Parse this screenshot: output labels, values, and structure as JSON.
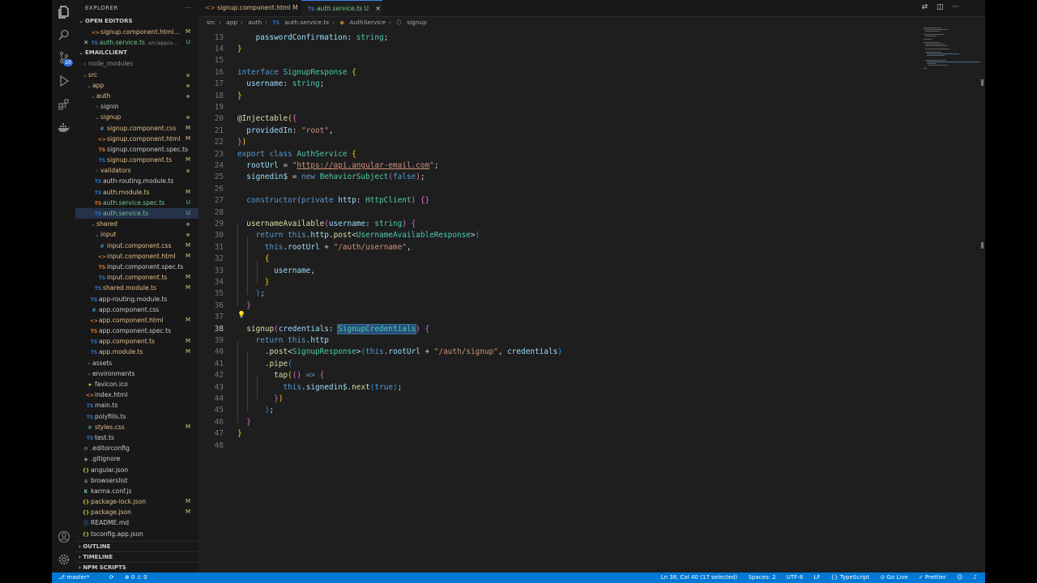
{
  "sidebar": {
    "title": "EXPLORER",
    "open_editors": "OPEN EDITORS",
    "project": "EMAILCLIENT",
    "outline": "OUTLINE",
    "timeline": "TIMELINE",
    "npm_scripts": "NPM SCRIPTS",
    "open_files": [
      {
        "name": "signup.component.html...",
        "status": "M"
      },
      {
        "name": "auth.service.ts",
        "path": "src/app/a...",
        "status": "U"
      }
    ],
    "tree": [
      {
        "label": "node_modules",
        "depth": 0,
        "kind": "folder",
        "status": ""
      },
      {
        "label": "src",
        "depth": 0,
        "kind": "folder-open",
        "status": "dot"
      },
      {
        "label": "app",
        "depth": 1,
        "kind": "folder-open",
        "status": "dot"
      },
      {
        "label": "auth",
        "depth": 2,
        "kind": "folder-open",
        "status": "dot"
      },
      {
        "label": "signin",
        "depth": 3,
        "kind": "folder",
        "status": ""
      },
      {
        "label": "signup",
        "depth": 3,
        "kind": "folder-open",
        "status": "dot"
      },
      {
        "label": "signup.component.css",
        "depth": 4,
        "kind": "css",
        "status": "M"
      },
      {
        "label": "signup.component.html",
        "depth": 4,
        "kind": "html",
        "status": "M"
      },
      {
        "label": "signup.component.spec.ts",
        "depth": 4,
        "kind": "spec",
        "status": ""
      },
      {
        "label": "signup.component.ts",
        "depth": 4,
        "kind": "ts",
        "status": "M"
      },
      {
        "label": "validators",
        "depth": 3,
        "kind": "folder",
        "status": "dot"
      },
      {
        "label": "auth-routing.module.ts",
        "depth": 3,
        "kind": "ts",
        "status": ""
      },
      {
        "label": "auth.module.ts",
        "depth": 3,
        "kind": "ts",
        "status": "M"
      },
      {
        "label": "auth.service.spec.ts",
        "depth": 3,
        "kind": "spec",
        "status": "U"
      },
      {
        "label": "auth.service.ts",
        "depth": 3,
        "kind": "ts",
        "status": "U",
        "selected": true
      },
      {
        "label": "shared",
        "depth": 2,
        "kind": "folder-open",
        "status": "dot"
      },
      {
        "label": "input",
        "depth": 3,
        "kind": "folder-open",
        "status": "dot"
      },
      {
        "label": "input.component.css",
        "depth": 4,
        "kind": "css",
        "status": "M"
      },
      {
        "label": "input.component.html",
        "depth": 4,
        "kind": "html",
        "status": "M"
      },
      {
        "label": "input.component.spec.ts",
        "depth": 4,
        "kind": "spec",
        "status": ""
      },
      {
        "label": "input.component.ts",
        "depth": 4,
        "kind": "ts",
        "status": "M"
      },
      {
        "label": "shared.module.ts",
        "depth": 3,
        "kind": "ts",
        "status": "M"
      },
      {
        "label": "app-routing.module.ts",
        "depth": 2,
        "kind": "ts",
        "status": ""
      },
      {
        "label": "app.component.css",
        "depth": 2,
        "kind": "css",
        "status": ""
      },
      {
        "label": "app.component.html",
        "depth": 2,
        "kind": "html",
        "status": "M"
      },
      {
        "label": "app.component.spec.ts",
        "depth": 2,
        "kind": "spec",
        "status": ""
      },
      {
        "label": "app.component.ts",
        "depth": 2,
        "kind": "ts",
        "status": "M"
      },
      {
        "label": "app.module.ts",
        "depth": 2,
        "kind": "ts",
        "status": "M"
      },
      {
        "label": "assets",
        "depth": 1,
        "kind": "folder",
        "status": ""
      },
      {
        "label": "environments",
        "depth": 1,
        "kind": "folder",
        "status": ""
      },
      {
        "label": "favicon.ico",
        "depth": 1,
        "kind": "ico",
        "status": ""
      },
      {
        "label": "index.html",
        "depth": 1,
        "kind": "html",
        "status": ""
      },
      {
        "label": "main.ts",
        "depth": 1,
        "kind": "ts",
        "status": ""
      },
      {
        "label": "polyfills.ts",
        "depth": 1,
        "kind": "ts",
        "status": ""
      },
      {
        "label": "styles.css",
        "depth": 1,
        "kind": "css",
        "status": "M"
      },
      {
        "label": "test.ts",
        "depth": 1,
        "kind": "ts",
        "status": ""
      },
      {
        "label": ".editorconfig",
        "depth": 0,
        "kind": "cfg",
        "status": ""
      },
      {
        "label": ".gitignore",
        "depth": 0,
        "kind": "git",
        "status": ""
      },
      {
        "label": "angular.json",
        "depth": 0,
        "kind": "json",
        "status": ""
      },
      {
        "label": "browserslist",
        "depth": 0,
        "kind": "list",
        "status": ""
      },
      {
        "label": "karma.conf.js",
        "depth": 0,
        "kind": "karma",
        "status": ""
      },
      {
        "label": "package-lock.json",
        "depth": 0,
        "kind": "json",
        "status": "M"
      },
      {
        "label": "package.json",
        "depth": 0,
        "kind": "json",
        "status": "M"
      },
      {
        "label": "README.md",
        "depth": 0,
        "kind": "md",
        "status": ""
      },
      {
        "label": "tsconfig.app.json",
        "depth": 0,
        "kind": "json",
        "status": ""
      }
    ]
  },
  "tabs": [
    {
      "label": "signup.component.html",
      "status": "M",
      "active": false,
      "icon": "<>"
    },
    {
      "label": "auth.service.ts",
      "status": "U",
      "active": true,
      "icon": "TS"
    }
  ],
  "breadcrumb": [
    "src",
    "app",
    "auth",
    "auth.service.ts",
    "AuthService",
    "signup"
  ],
  "code": [
    {
      "n": 13,
      "t": [
        [
          "    ",
          ""
        ],
        [
          "passwordConfirmation",
          "vr"
        ],
        [
          ": ",
          ""
        ],
        [
          "string",
          "ty"
        ],
        [
          ";",
          ""
        ]
      ]
    },
    {
      "n": 14,
      "t": [
        [
          "}",
          "pn"
        ]
      ]
    },
    {
      "n": 15,
      "t": []
    },
    {
      "n": 16,
      "t": [
        [
          "interface ",
          "kw"
        ],
        [
          "SignupResponse ",
          "ty"
        ],
        [
          "{",
          "pn"
        ]
      ]
    },
    {
      "n": 17,
      "t": [
        [
          "  ",
          ""
        ],
        [
          "username",
          "vr"
        ],
        [
          ": ",
          ""
        ],
        [
          "string",
          "ty"
        ],
        [
          ";",
          ""
        ]
      ]
    },
    {
      "n": 18,
      "t": [
        [
          "}",
          "pn"
        ]
      ]
    },
    {
      "n": 19,
      "t": []
    },
    {
      "n": 20,
      "t": [
        [
          "@",
          "dc"
        ],
        [
          "Injectable",
          "dc"
        ],
        [
          "(",
          "pn"
        ],
        [
          "{",
          "pp"
        ]
      ]
    },
    {
      "n": 21,
      "t": [
        [
          "  ",
          ""
        ],
        [
          "providedIn",
          "vr"
        ],
        [
          ": ",
          ""
        ],
        [
          "\"root\"",
          "st"
        ],
        [
          ",",
          ""
        ]
      ]
    },
    {
      "n": 22,
      "t": [
        [
          "}",
          "pp"
        ],
        [
          ")",
          "pn"
        ]
      ]
    },
    {
      "n": 23,
      "t": [
        [
          "export ",
          "kw"
        ],
        [
          "class ",
          "kw"
        ],
        [
          "AuthService ",
          "ty"
        ],
        [
          "{",
          "pn"
        ]
      ]
    },
    {
      "n": 24,
      "t": [
        [
          "  ",
          ""
        ],
        [
          "rootUrl",
          "vr"
        ],
        [
          " = ",
          ""
        ],
        [
          "\"",
          "st"
        ],
        [
          "https://api.angular-email.com",
          "ur"
        ],
        [
          "\"",
          "st"
        ],
        [
          ";",
          ""
        ]
      ]
    },
    {
      "n": 25,
      "t": [
        [
          "  ",
          ""
        ],
        [
          "signedin$",
          "vr"
        ],
        [
          " = ",
          ""
        ],
        [
          "new ",
          "kw"
        ],
        [
          "BehaviorSubject",
          "ty"
        ],
        [
          "(",
          "pp"
        ],
        [
          "false",
          "kw"
        ],
        [
          ")",
          "pp"
        ],
        [
          ";",
          ""
        ]
      ]
    },
    {
      "n": 26,
      "t": []
    },
    {
      "n": 27,
      "t": [
        [
          "  ",
          ""
        ],
        [
          "constructor",
          "kw"
        ],
        [
          "(",
          "pp"
        ],
        [
          "private ",
          "kw"
        ],
        [
          "http",
          "vr"
        ],
        [
          ": ",
          ""
        ],
        [
          "HttpClient",
          "ty"
        ],
        [
          ") ",
          "pp"
        ],
        [
          "{}",
          "pp"
        ]
      ]
    },
    {
      "n": 28,
      "t": []
    },
    {
      "n": 29,
      "t": [
        [
          "  ",
          ""
        ],
        [
          "usernameAvailable",
          "fn"
        ],
        [
          "(",
          "pp"
        ],
        [
          "username",
          "vr"
        ],
        [
          ": ",
          ""
        ],
        [
          "string",
          "ty"
        ],
        [
          ") ",
          "pp"
        ],
        [
          "{",
          "pp"
        ]
      ]
    },
    {
      "n": 30,
      "t": [
        [
          "    ",
          ""
        ],
        [
          "return ",
          "kw"
        ],
        [
          "this",
          "kw"
        ],
        [
          ".",
          ""
        ],
        [
          "http",
          "vr"
        ],
        [
          ".",
          ""
        ],
        [
          "post",
          "fn"
        ],
        [
          "<",
          ""
        ],
        [
          "UsernameAvailableResponse",
          "ty"
        ],
        [
          ">",
          ""
        ],
        [
          "(",
          "pb"
        ]
      ]
    },
    {
      "n": 31,
      "t": [
        [
          "      ",
          ""
        ],
        [
          "this",
          "kw"
        ],
        [
          ".",
          ""
        ],
        [
          "rootUrl",
          "vr"
        ],
        [
          " + ",
          ""
        ],
        [
          "\"/auth/username\"",
          "st"
        ],
        [
          ",",
          ""
        ]
      ]
    },
    {
      "n": 32,
      "t": [
        [
          "      ",
          ""
        ],
        [
          "{",
          "pn"
        ]
      ]
    },
    {
      "n": 33,
      "t": [
        [
          "        ",
          ""
        ],
        [
          "username",
          "vr"
        ],
        [
          ",",
          ""
        ]
      ]
    },
    {
      "n": 34,
      "t": [
        [
          "      ",
          ""
        ],
        [
          "}",
          "pn"
        ]
      ]
    },
    {
      "n": 35,
      "t": [
        [
          "    ",
          ""
        ],
        [
          ")",
          "pb"
        ],
        [
          ";",
          ""
        ]
      ]
    },
    {
      "n": 36,
      "t": [
        [
          "  ",
          ""
        ],
        [
          "}",
          "pp"
        ]
      ]
    },
    {
      "n": 37,
      "t": []
    },
    {
      "n": 38,
      "t": [
        [
          "  ",
          ""
        ],
        [
          "signup",
          "fn"
        ],
        [
          "(",
          "pp"
        ],
        [
          "credentials",
          "vr"
        ],
        [
          ": ",
          ""
        ],
        [
          "SignupCredentials",
          "ty hl"
        ],
        [
          ") ",
          "pp"
        ],
        [
          "{",
          "pp"
        ]
      ],
      "current": true
    },
    {
      "n": 39,
      "t": [
        [
          "    ",
          ""
        ],
        [
          "return ",
          "kw"
        ],
        [
          "this",
          "kw"
        ],
        [
          ".",
          ""
        ],
        [
          "http",
          "vr"
        ]
      ]
    },
    {
      "n": 40,
      "t": [
        [
          "      ",
          ""
        ],
        [
          ".",
          ""
        ],
        [
          "post",
          "fn"
        ],
        [
          "<",
          ""
        ],
        [
          "SignupResponse",
          "ty"
        ],
        [
          ">",
          ""
        ],
        [
          "(",
          "pb"
        ],
        [
          "this",
          "kw"
        ],
        [
          ".",
          ""
        ],
        [
          "rootUrl",
          "vr"
        ],
        [
          " + ",
          ""
        ],
        [
          "\"/auth/signup\"",
          "st"
        ],
        [
          ", ",
          ""
        ],
        [
          "credentials",
          "vr"
        ],
        [
          ")",
          "pb"
        ]
      ]
    },
    {
      "n": 41,
      "t": [
        [
          "      ",
          ""
        ],
        [
          ".",
          ""
        ],
        [
          "pipe",
          "fn"
        ],
        [
          "(",
          "pb"
        ]
      ]
    },
    {
      "n": 42,
      "t": [
        [
          "        ",
          ""
        ],
        [
          "tap",
          "fn"
        ],
        [
          "(",
          "pn"
        ],
        [
          "() ",
          "pp"
        ],
        [
          "=> ",
          "kw"
        ],
        [
          "{",
          "pp"
        ]
      ]
    },
    {
      "n": 43,
      "t": [
        [
          "          ",
          ""
        ],
        [
          "this",
          "kw"
        ],
        [
          ".",
          ""
        ],
        [
          "signedin$",
          "vr"
        ],
        [
          ".",
          ""
        ],
        [
          "next",
          "fn"
        ],
        [
          "(",
          "pb"
        ],
        [
          "true",
          "kw"
        ],
        [
          ")",
          "pb"
        ],
        [
          ";",
          ""
        ]
      ]
    },
    {
      "n": 44,
      "t": [
        [
          "        ",
          ""
        ],
        [
          "}",
          "pp"
        ],
        [
          ")",
          "pn"
        ]
      ]
    },
    {
      "n": 45,
      "t": [
        [
          "      ",
          ""
        ],
        [
          ")",
          "pb"
        ],
        [
          ";",
          ""
        ]
      ]
    },
    {
      "n": 46,
      "t": [
        [
          "  ",
          ""
        ],
        [
          "}",
          "pp"
        ]
      ]
    },
    {
      "n": 47,
      "t": [
        [
          "}",
          "pn"
        ]
      ]
    },
    {
      "n": 48,
      "t": []
    }
  ],
  "status": {
    "branch": "master*",
    "sync": "⟳",
    "problems": "⊗ 0 ⚠ 0",
    "position": "Ln 38, Col 40 (17 selected)",
    "spaces": "Spaces: 2",
    "encoding": "UTF-8",
    "eol": "LF",
    "language": "{} TypeScript",
    "golive": "⊙ Go Live",
    "prettier": "✓ Prettier",
    "feedback": "☺",
    "bell": "♪"
  },
  "badge_count": "20",
  "colors": {
    "accent": "#0078d4",
    "modified": "#e2c08d",
    "untracked": "#73c991"
  }
}
